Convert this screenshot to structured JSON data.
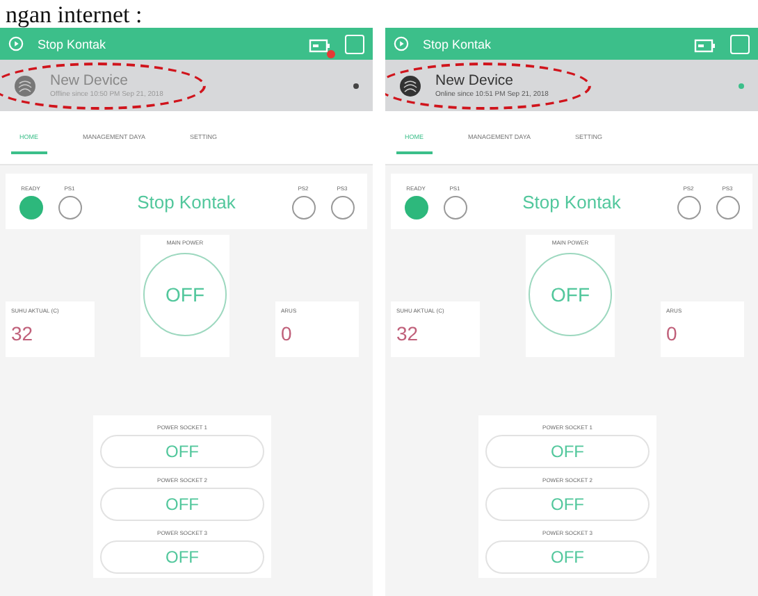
{
  "caption": "ngan internet :",
  "phones": [
    {
      "title": "Stop Kontak",
      "notification": true,
      "device": {
        "name": "New Device",
        "status": "Offline since 10:50 PM Sep 21, 2018",
        "online": false
      },
      "tabs": [
        {
          "label": "HOME",
          "selected": true
        },
        {
          "label": "MANAGEMENT DAYA",
          "selected": false
        },
        {
          "label": "SETTING",
          "selected": false
        }
      ],
      "leds": [
        {
          "label": "READY",
          "on": true
        },
        {
          "label": "PS1",
          "on": false
        },
        {
          "label": "PS2",
          "on": false
        },
        {
          "label": "PS3",
          "on": false
        }
      ],
      "display": "Stop Kontak",
      "main_power": {
        "label": "MAIN POWER",
        "value": "OFF"
      },
      "left_value": {
        "label": "SUHU AKTUAL (C)",
        "value": "32"
      },
      "right_value": {
        "label": "ARUS",
        "value": "0"
      },
      "sockets": [
        {
          "label": "POWER SOCKET 1",
          "value": "OFF"
        },
        {
          "label": "POWER SOCKET 2",
          "value": "OFF"
        },
        {
          "label": "POWER SOCKET 3",
          "value": "OFF"
        }
      ]
    },
    {
      "title": "Stop Kontak",
      "notification": false,
      "device": {
        "name": "New Device",
        "status": "Online since 10:51 PM Sep 21, 2018",
        "online": true
      },
      "tabs": [
        {
          "label": "HOME",
          "selected": true
        },
        {
          "label": "MANAGEMENT DAYA",
          "selected": false
        },
        {
          "label": "SETTING",
          "selected": false
        }
      ],
      "leds": [
        {
          "label": "READY",
          "on": true
        },
        {
          "label": "PS1",
          "on": false
        },
        {
          "label": "PS2",
          "on": false
        },
        {
          "label": "PS3",
          "on": false
        }
      ],
      "display": "Stop Kontak",
      "main_power": {
        "label": "MAIN POWER",
        "value": "OFF"
      },
      "left_value": {
        "label": "SUHU AKTUAL (C)",
        "value": "32"
      },
      "right_value": {
        "label": "ARUS",
        "value": "0"
      },
      "sockets": [
        {
          "label": "POWER SOCKET 1",
          "value": "OFF"
        },
        {
          "label": "POWER SOCKET 2",
          "value": "OFF"
        },
        {
          "label": "POWER SOCKET 3",
          "value": "OFF"
        }
      ]
    }
  ]
}
